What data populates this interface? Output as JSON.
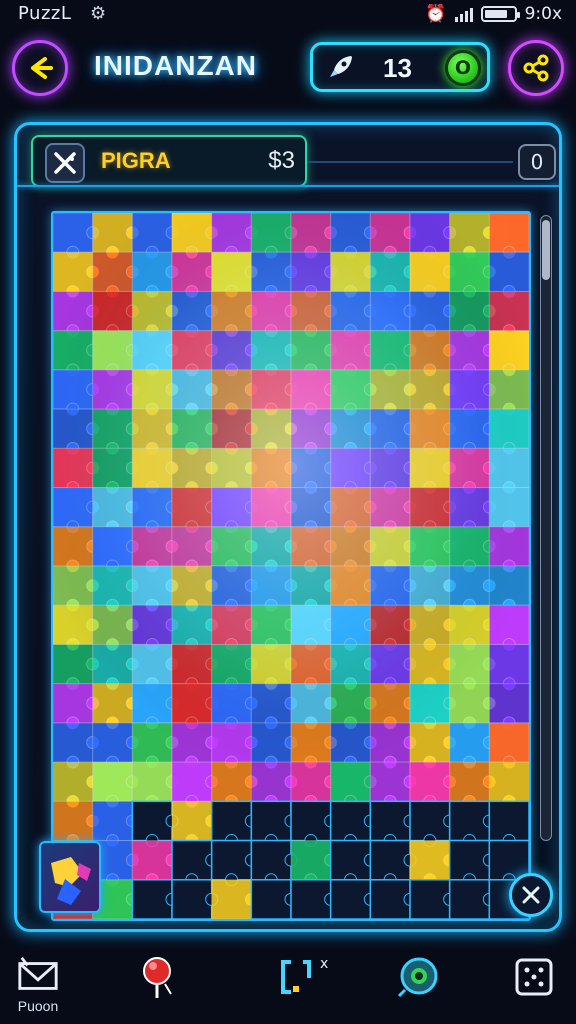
{
  "status_bar": {
    "app_name": "PuzzL",
    "time": "9:0x"
  },
  "header": {
    "title": "INIDANZAN",
    "counter_value": "13",
    "counter_badge": "O"
  },
  "toolbar": {
    "label": "PIGRA",
    "price": "$3",
    "count": "0"
  },
  "bottom_nav": {
    "first_label": "Puoon",
    "hint_glyph": "x"
  },
  "colors": {
    "neon_cyan": "#23c6ff",
    "neon_purple": "#c24cff",
    "accent_yellow": "#ffd21f",
    "badge_green": "#21c21a",
    "background": "#070b17"
  },
  "icons": [
    "settings-icon",
    "alarm-icon",
    "signal-icon",
    "battery-icon",
    "back-arrow-icon",
    "rocket-icon",
    "share-icon",
    "shuffle-icon",
    "close-icon",
    "mail-icon",
    "pin-icon",
    "frame-icon",
    "eye-icon",
    "dice-icon"
  ]
}
